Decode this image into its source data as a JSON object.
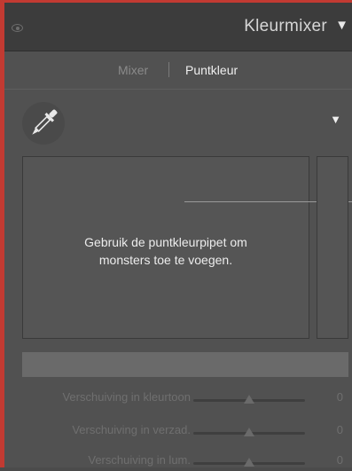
{
  "header": {
    "title": "Kleurmixer",
    "collapse_glyph": "▼",
    "visibility_icon": "eye-icon"
  },
  "tabs": [
    {
      "label": "Mixer",
      "active": false
    },
    {
      "label": "Puntkleur",
      "active": true
    }
  ],
  "picker": {
    "icon": "eyedropper-icon",
    "menu_glyph": "▼"
  },
  "sample_area": {
    "line1": "Gebruik de puntkleurpipet om",
    "line2": "monsters toe te voegen."
  },
  "sliders": [
    {
      "label": "Verschuiving in kleurtoon",
      "value": "0",
      "position": 0.5
    },
    {
      "label": "Verschuiving in verzad.",
      "value": "0",
      "position": 0.5
    },
    {
      "label": "Verschuiving in lum.",
      "value": "0",
      "position": 0.5
    }
  ],
  "colors": {
    "accent_border": "#c23a32",
    "panel_bg": "#515151",
    "header_bg": "#3c3c3c"
  }
}
